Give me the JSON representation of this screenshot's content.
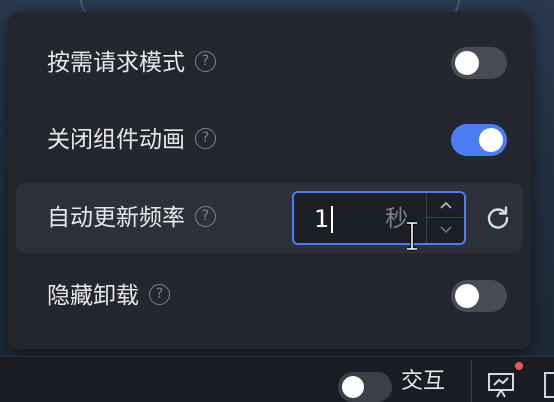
{
  "settings": [
    {
      "label": "按需请求模式",
      "enabled": false
    },
    {
      "label": "关闭组件动画",
      "enabled": true
    },
    {
      "label": "自动更新频率",
      "input_value": "1",
      "unit": "秒"
    },
    {
      "label": "隐藏卸载",
      "enabled": false
    }
  ],
  "help_glyph": "?",
  "toolbar": {
    "interaction_label": "交互",
    "interaction_enabled": false
  },
  "colors": {
    "accent": "#4b7cf3",
    "panel_bg": "#23262d",
    "notification_dot": "#e85a4f"
  }
}
